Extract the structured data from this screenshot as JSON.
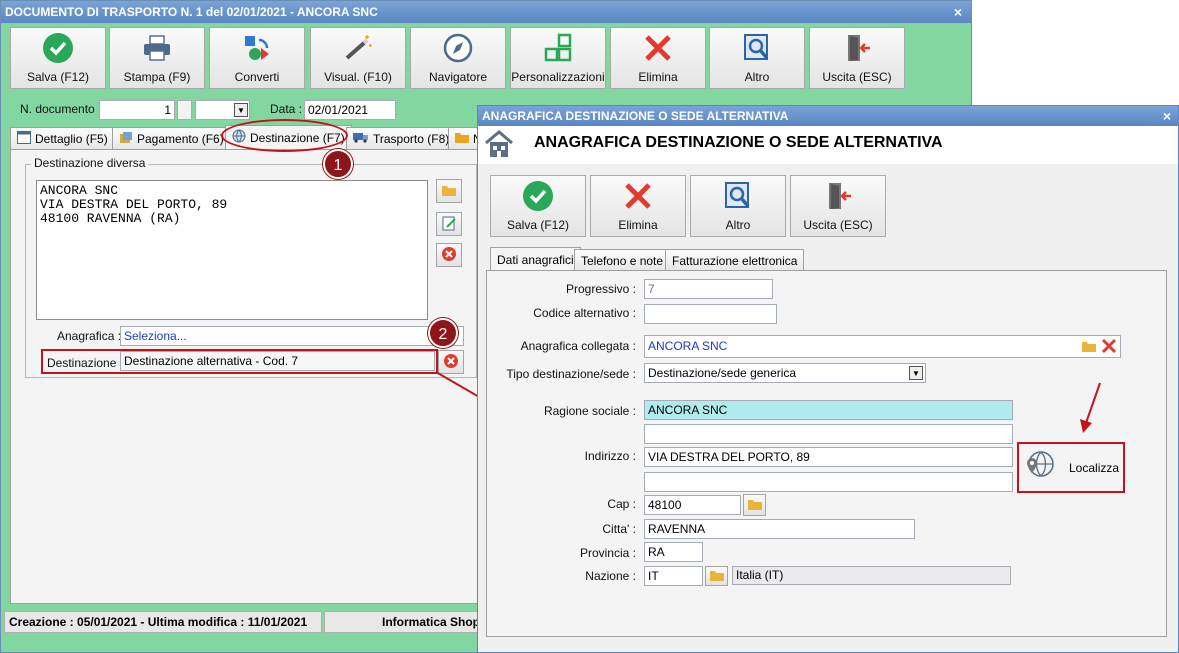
{
  "main_window": {
    "title": "DOCUMENTO DI TRASPORTO N. 1 del 02/01/2021 - ANCORA SNC",
    "close": "×",
    "toolbar": {
      "buttons": [
        {
          "label": "Salva (F12)",
          "icon": "check-circle-icon"
        },
        {
          "label": "Stampa (F9)",
          "icon": "printer-icon"
        },
        {
          "label": "Converti",
          "icon": "convert-icon"
        },
        {
          "label": "Visual. (F10)",
          "icon": "wand-icon"
        },
        {
          "label": "Navigatore",
          "icon": "compass-icon"
        },
        {
          "label": "Personalizzazioni",
          "icon": "grid-icon"
        },
        {
          "label": "Elimina",
          "icon": "red-x-icon"
        },
        {
          "label": "Altro",
          "icon": "magnifier-icon"
        },
        {
          "label": "Uscita (ESC)",
          "icon": "exit-door-icon"
        }
      ]
    },
    "doc_number_label": "N. documento :",
    "doc_number_value": "1",
    "date_label": "Data :",
    "date_value": "02/01/2021",
    "tabs": [
      {
        "label": "Dettaglio (F5)",
        "icon": "list-icon"
      },
      {
        "label": "Pagamento (F6)",
        "icon": "payment-icon"
      },
      {
        "label": "Destinazione (F7)",
        "icon": "globe-icon"
      },
      {
        "label": "Trasporto (F8)",
        "icon": "truck-icon"
      },
      {
        "label": "N",
        "icon": "folder-icon"
      }
    ],
    "group_title": "Destinazione diversa",
    "address_lines": [
      "ANCORA SNC",
      "VIA DESTRA DEL PORTO, 89",
      "48100 RAVENNA (RA)"
    ],
    "anagrafica_label": "Anagrafica :",
    "anagrafica_value": "Seleziona...",
    "destinazione_label": "Destinazione :",
    "destinazione_value": "Destinazione alternativa - Cod. 7",
    "status_text": "Creazione : 05/01/2021 - Ultima modifica : 11/01/2021",
    "status_company": "Informatica Shop"
  },
  "badges": [
    "1",
    "2"
  ],
  "dialog": {
    "title": "ANAGRAFICA DESTINAZIONE O SEDE ALTERNATIVA",
    "close": "×",
    "header_text": "ANAGRAFICA DESTINAZIONE O SEDE ALTERNATIVA",
    "toolbar": {
      "buttons": [
        {
          "label": "Salva (F12)",
          "icon": "check-circle-icon"
        },
        {
          "label": "Elimina",
          "icon": "red-x-icon"
        },
        {
          "label": "Altro",
          "icon": "magnifier-icon"
        },
        {
          "label": "Uscita (ESC)",
          "icon": "exit-door-icon"
        }
      ]
    },
    "tabs": [
      "Dati anagrafici",
      "Telefono e note",
      "Fatturazione elettronica"
    ],
    "fields": {
      "progressivo_label": "Progressivo :",
      "progressivo_value": "7",
      "codice_alt_label": "Codice alternativo :",
      "codice_alt_value": "",
      "anagrafica_collegata_label": "Anagrafica collegata :",
      "anagrafica_collegata_value": "ANCORA SNC",
      "tipo_label": "Tipo destinazione/sede :",
      "tipo_value": "Destinazione/sede generica",
      "ragione_label": "Ragione sociale :",
      "ragione_value": "ANCORA SNC",
      "ragione_value2": "",
      "indirizzo_label": "Indirizzo :",
      "indirizzo_value": "VIA DESTRA DEL PORTO, 89",
      "indirizzo_value2": "",
      "cap_label": "Cap :",
      "cap_value": "48100",
      "citta_label": "Citta' :",
      "citta_value": "RAVENNA",
      "provincia_label": "Provincia :",
      "provincia_value": "RA",
      "nazione_label": "Nazione :",
      "nazione_code": "IT",
      "nazione_name": "Italia (IT)"
    },
    "localizza_label": "Localizza"
  },
  "colors": {
    "main_bg": "#82d7a0",
    "title_bar": "#5a86c2",
    "highlight_red": "#c0161b",
    "badge": "#8e1518",
    "ragione_bg": "#b0ecef"
  }
}
